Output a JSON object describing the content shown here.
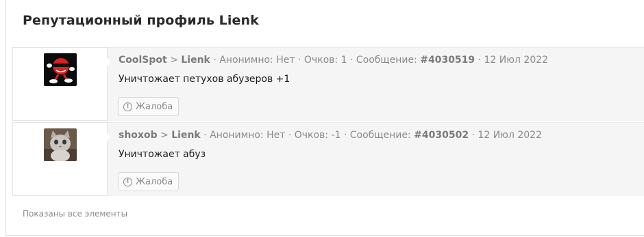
{
  "page": {
    "title": "Репутационный профиль Lienk",
    "footer_text": "Показаны все элементы"
  },
  "items": [
    {
      "from_user": "CoolSpot",
      "arrow": ">",
      "to_user": "Lienk",
      "anon_text": "· Анонимно: Нет · Очков: 1 · Сообщение: ",
      "message_link": "#4030519",
      "date_text": " · 12 Июл 2022",
      "comment": "Уничтожает петухов абузеров +1",
      "report_label": "Жалоба",
      "avatar_icon": "coolspot-avatar"
    },
    {
      "from_user": "shoxob",
      "arrow": ">",
      "to_user": "Lienk",
      "anon_text": "· Анонимно: Нет · Очков: -1 · Сообщение: ",
      "message_link": "#4030502",
      "date_text": " · 12 Июл 2022",
      "comment": "Уничтожает абуз",
      "report_label": "Жалоба",
      "avatar_icon": "cat-avatar"
    }
  ],
  "colors": {
    "content_bg": "#f5f5f5",
    "meta_text": "#8a8a8a",
    "body_text": "#1a1a1a"
  }
}
